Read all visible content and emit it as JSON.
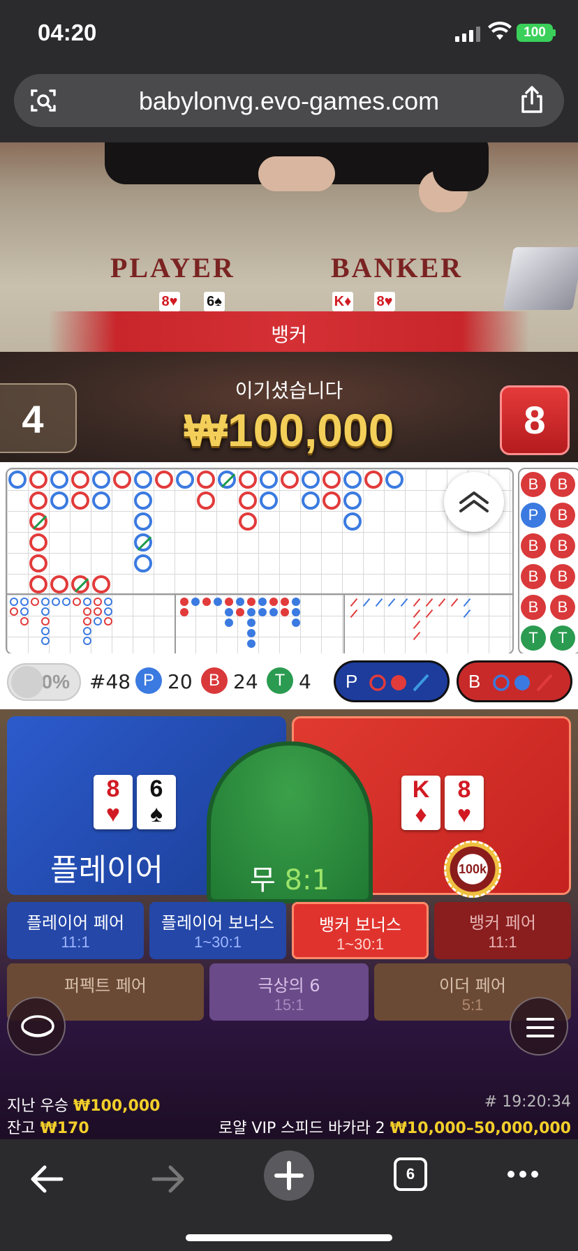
{
  "status": {
    "time": "04:20",
    "battery": "100"
  },
  "browser": {
    "url": "babylonvg.evo-games.com",
    "tab_count": "6"
  },
  "video": {
    "player_label": "PLAYER",
    "banker_label": "BANKER",
    "player_cards": [
      {
        "rank": "8",
        "suit": "♥",
        "color": "red"
      },
      {
        "rank": "6",
        "suit": "♠",
        "color": "black"
      }
    ],
    "banker_cards": [
      {
        "rank": "K",
        "suit": "♦",
        "color": "red"
      },
      {
        "rank": "8",
        "suit": "♥",
        "color": "red"
      }
    ],
    "result_banner": "뱅커",
    "win_label": "이기셨습니다",
    "win_amount": "₩100,000",
    "player_score": "4",
    "banker_score": "8"
  },
  "stats": {
    "percent": "0%",
    "round": "#48",
    "player_letter": "P",
    "player_count": "20",
    "banker_letter": "B",
    "banker_count": "24",
    "tie_letter": "T",
    "tie_count": "4",
    "predict_player": "P",
    "predict_banker": "B"
  },
  "bets": {
    "player": {
      "label": "플레이어"
    },
    "tie": {
      "label": "무",
      "odds": "8:1"
    },
    "banker": {
      "chip": "100k"
    },
    "side_row1": [
      {
        "name": "플레이어 페어",
        "odds": "11:1"
      },
      {
        "name": "플레이어 보너스",
        "odds": "1~30:1"
      },
      {
        "name": "뱅커 보너스",
        "odds": "1~30:1"
      },
      {
        "name": "뱅커 페어",
        "odds": "11:1"
      }
    ],
    "side_row2": [
      {
        "name": "퍼펙트 페어",
        "odds": ""
      },
      {
        "name": "극상의 6",
        "odds": "15:1"
      },
      {
        "name": "이더 페어",
        "odds": "5:1"
      }
    ]
  },
  "footer": {
    "last_win_label": "지난 우승",
    "last_win_value": "₩100,000",
    "balance_label": "잔고",
    "balance_value": "₩170",
    "game_id": "# 19:20:34",
    "table_name": "로얄 VIP 스피드 바카라 2",
    "limits": "₩10,000–50,000,000"
  },
  "colors": {
    "player_blue": "#3b7ae0",
    "banker_red": "#e23b3b",
    "tie_green": "#2a9b50",
    "gold": "#f3cf2a"
  }
}
